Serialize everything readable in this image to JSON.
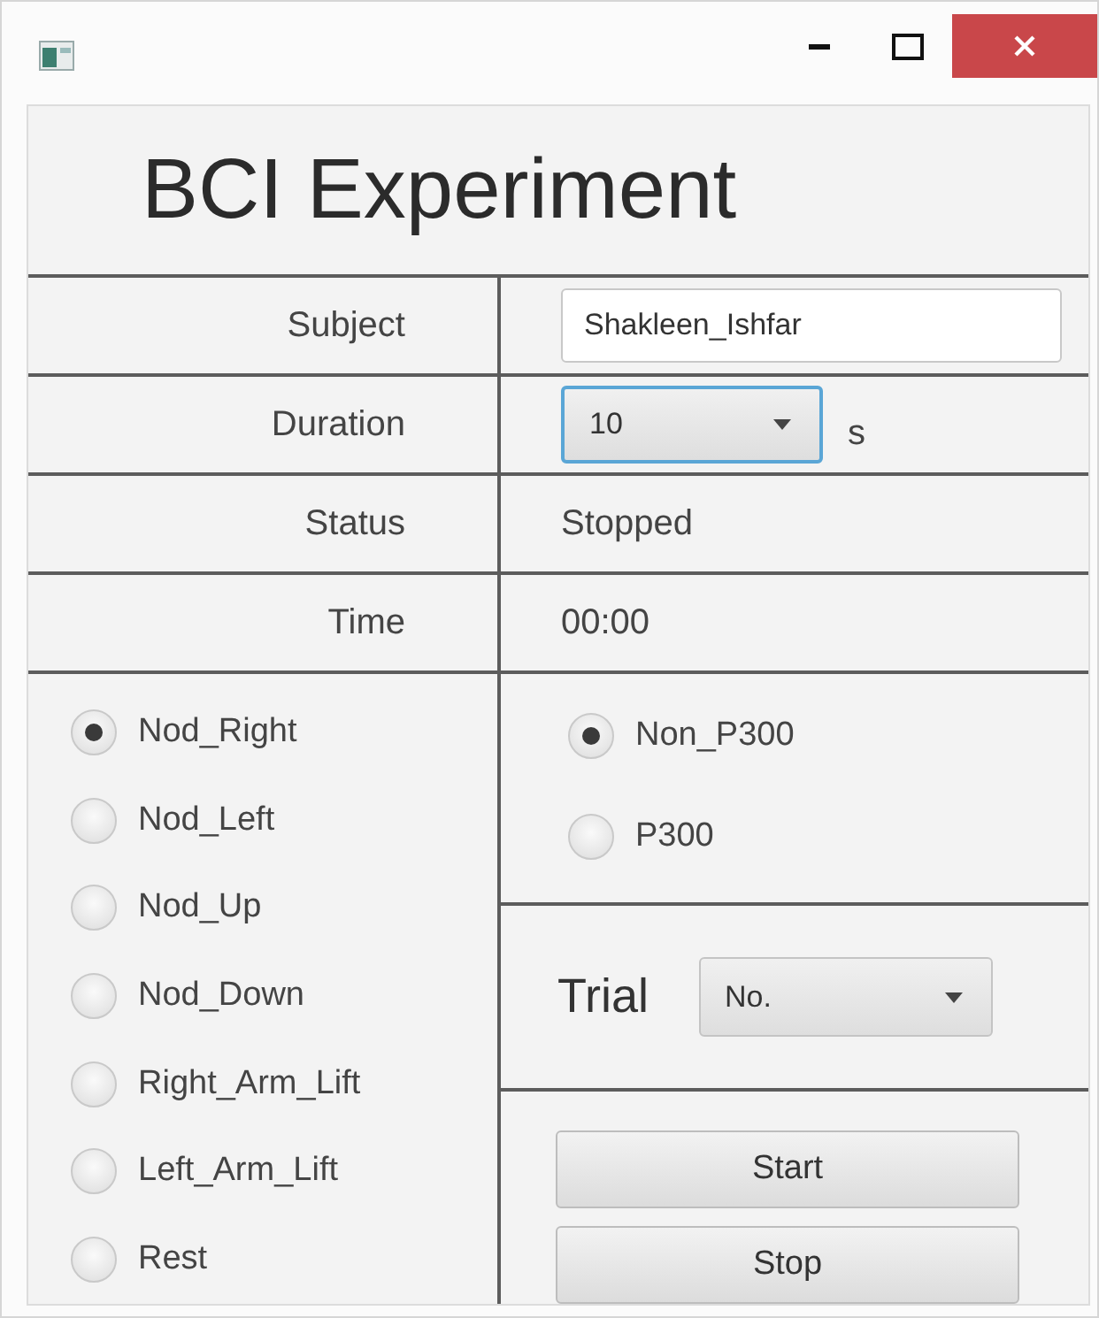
{
  "heading": "BCI Experiment",
  "fields": [
    {
      "label": "Subject",
      "kind": "text",
      "value": "Shakleen_Ishfar"
    },
    {
      "label": "Duration",
      "kind": "combo",
      "value": "10",
      "unit": "s",
      "focused": true
    },
    {
      "label": "Status",
      "kind": "readout",
      "value": "Stopped"
    },
    {
      "label": "Time",
      "kind": "readout",
      "value": "00:00"
    }
  ],
  "movements": [
    {
      "label": "Nod_Right",
      "selected": true
    },
    {
      "label": "Nod_Left",
      "selected": false
    },
    {
      "label": "Nod_Up",
      "selected": false
    },
    {
      "label": "Nod_Down",
      "selected": false
    },
    {
      "label": "Right_Arm_Lift",
      "selected": false
    },
    {
      "label": "Left_Arm_Lift",
      "selected": false
    },
    {
      "label": "Rest",
      "selected": false
    }
  ],
  "modes": [
    {
      "label": "Non_P300",
      "selected": true
    },
    {
      "label": "P300",
      "selected": false
    }
  ],
  "trial": {
    "label": "Trial",
    "value": "No."
  },
  "buttons": [
    "Start",
    "Stop"
  ]
}
